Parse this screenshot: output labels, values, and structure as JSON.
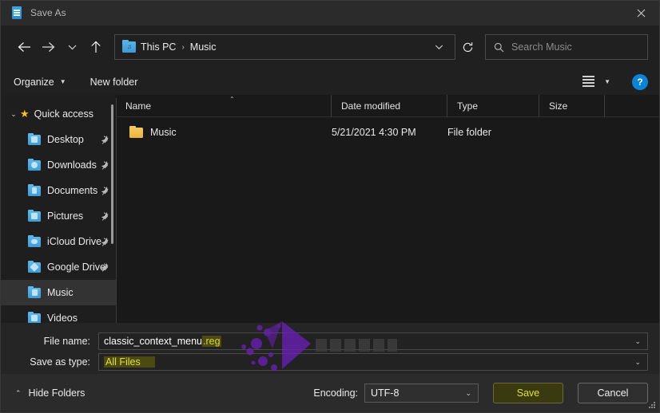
{
  "titlebar": {
    "title": "Save As",
    "icon": "notepad-icon",
    "close_label": "✕"
  },
  "nav": {
    "back_icon": "arrow-left-icon",
    "forward_icon": "arrow-right-icon",
    "recent_icon": "chevron-down-icon",
    "up_icon": "arrow-up-icon",
    "refresh_icon": "refresh-icon",
    "breadcrumb": {
      "folder_icon": "music-folder-icon",
      "crumbs": [
        "This PC",
        "Music"
      ],
      "separator": "›",
      "caret": "⌄"
    },
    "search": {
      "icon": "search-icon",
      "placeholder": "Search Music"
    }
  },
  "commandbar": {
    "organize_label": "Organize",
    "organize_caret": "▼",
    "new_folder_label": "New folder",
    "view_icon": "list-view-icon",
    "view_caret": "▼",
    "help_label": "?"
  },
  "sidebar": {
    "root": {
      "label": "Quick access",
      "chevron": "⌄",
      "icon": "star-icon"
    },
    "items": [
      {
        "label": "Desktop",
        "icon": "folder-icon",
        "pin": "pin-icon",
        "selected": false
      },
      {
        "label": "Downloads",
        "icon": "folder-icon",
        "pin": "pin-icon",
        "selected": false
      },
      {
        "label": "Documents",
        "icon": "folder-icon",
        "pin": "pin-icon",
        "selected": false
      },
      {
        "label": "Pictures",
        "icon": "folder-icon",
        "pin": "pin-icon",
        "selected": false
      },
      {
        "label": "iCloud Drive",
        "icon": "folder-icon",
        "pin": "pin-icon",
        "selected": false
      },
      {
        "label": "Google Drive",
        "icon": "folder-icon",
        "pin": "pin-icon",
        "selected": false
      },
      {
        "label": "Music",
        "icon": "folder-icon",
        "pin": "",
        "selected": true
      },
      {
        "label": "Videos",
        "icon": "folder-icon",
        "pin": "",
        "selected": false
      }
    ]
  },
  "filelist": {
    "columns": [
      "Name",
      "Date modified",
      "Type",
      "Size"
    ],
    "sort_caret": "⌃",
    "rows": [
      {
        "name": "Music",
        "date_modified": "5/21/2021 4:30 PM",
        "type": "File folder",
        "size": "",
        "icon": "yellow-folder-icon"
      }
    ]
  },
  "form": {
    "file_name_label": "File name:",
    "file_name_base": "classic_context_menu",
    "file_name_ext": ".reg",
    "save_as_type_label": "Save as type:",
    "save_as_type_value": "All Files",
    "caret": "⌄"
  },
  "footer": {
    "hide_folders_label": "Hide Folders",
    "hide_folders_caret": "⌃",
    "encoding_label": "Encoding:",
    "encoding_value": "UTF-8",
    "encoding_caret": "⌄",
    "save_label": "Save",
    "cancel_label": "Cancel"
  },
  "colors": {
    "accent_blue": "#0a84d8",
    "folder_yellow": "#e8b33e",
    "selection_yellow": "#e2e22e",
    "selection_bg": "#4a4a12",
    "star_gold": "#f5c518",
    "watermark_purple": "#6a1fb5"
  }
}
